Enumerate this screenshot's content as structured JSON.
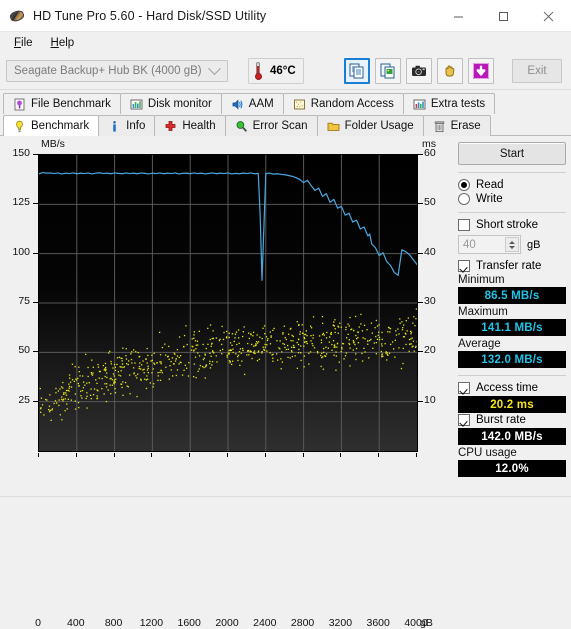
{
  "window": {
    "title": "HD Tune Pro 5.60 - Hard Disk/SSD Utility",
    "icon": "hdd-platter-icon",
    "minimize": "minimize-icon",
    "maximize": "maximize-icon",
    "close": "close-icon"
  },
  "menu": {
    "items": [
      {
        "label": "File",
        "accel": "F"
      },
      {
        "label": "Help",
        "accel": "H"
      }
    ]
  },
  "toolbar": {
    "drive": "Seagate Backup+ Hub BK (4000 gB)",
    "temperature": "46°C",
    "buttons": [
      {
        "name": "copy-text-button",
        "icon": "copy-document-icon",
        "selected": true
      },
      {
        "name": "copy-image-button",
        "icon": "copy-image-icon",
        "selected": false
      },
      {
        "name": "screenshot-button",
        "icon": "camera-icon",
        "selected": false
      },
      {
        "name": "hand-tool-button",
        "icon": "hand-icon",
        "selected": false
      },
      {
        "name": "save-button",
        "icon": "download-arrow-icon",
        "selected": false
      }
    ],
    "exit_label": "Exit"
  },
  "tabs": {
    "row1": [
      {
        "label": "File Benchmark",
        "icon": "file-benchmark-icon",
        "active": false
      },
      {
        "label": "Disk monitor",
        "icon": "disk-monitor-icon",
        "active": false
      },
      {
        "label": "AAM",
        "icon": "speaker-icon",
        "active": false
      },
      {
        "label": "Random Access",
        "icon": "random-access-icon",
        "active": false
      },
      {
        "label": "Extra tests",
        "icon": "extra-tests-icon",
        "active": false
      }
    ],
    "row2": [
      {
        "label": "Benchmark",
        "icon": "lightbulb-icon",
        "active": true
      },
      {
        "label": "Info",
        "icon": "info-icon",
        "active": false
      },
      {
        "label": "Health",
        "icon": "health-cross-icon",
        "active": false
      },
      {
        "label": "Error Scan",
        "icon": "magnifier-icon",
        "active": false
      },
      {
        "label": "Folder Usage",
        "icon": "folder-icon",
        "active": false
      },
      {
        "label": "Erase",
        "icon": "trash-icon",
        "active": false
      }
    ]
  },
  "panel": {
    "start_label": "Start",
    "read_label": "Read",
    "write_label": "Write",
    "read_selected": true,
    "short_stroke_label": "Short stroke",
    "short_stroke_checked": false,
    "short_stroke_value": "40",
    "short_stroke_unit": "gB",
    "transfer_rate_label": "Transfer rate",
    "transfer_rate_checked": true,
    "minimum_label": "Minimum",
    "minimum_value": "86.5 MB/s",
    "maximum_label": "Maximum",
    "maximum_value": "141.1 MB/s",
    "average_label": "Average",
    "average_value": "132.0 MB/s",
    "access_time_label": "Access time",
    "access_time_checked": true,
    "access_time_value": "20.2 ms",
    "burst_rate_label": "Burst rate",
    "burst_rate_checked": true,
    "burst_rate_value": "142.0 MB/s",
    "cpu_usage_label": "CPU usage",
    "cpu_usage_value": "12.0%"
  },
  "chart_data": {
    "type": "line",
    "title": "",
    "xlabel": "gB",
    "ylabel": "MB/s",
    "y2label": "ms",
    "xlim": [
      0,
      4000
    ],
    "ylim": [
      0,
      150
    ],
    "y2lim": [
      0,
      60
    ],
    "grid": true,
    "background": "#000000",
    "xticks": [
      0,
      400,
      800,
      1200,
      1600,
      2000,
      2400,
      2800,
      3200,
      3600,
      4000
    ],
    "xticklabels": [
      "0",
      "400",
      "800",
      "1200",
      "1600",
      "2000",
      "2400",
      "2800",
      "3200",
      "3600",
      "4000"
    ],
    "xunit_suffix": "gB",
    "yticks": [
      25,
      50,
      75,
      100,
      125,
      150
    ],
    "yticklabels": [
      "25",
      "50",
      "75",
      "100",
      "125",
      "150"
    ],
    "y2ticks": [
      10,
      20,
      30,
      40,
      50,
      60
    ],
    "y2ticklabels": [
      "10",
      "20",
      "30",
      "40",
      "50",
      "60"
    ],
    "series": [
      {
        "name": "Transfer rate",
        "type": "line",
        "color": "#4aa8e0",
        "axis": "left",
        "unit": "MB/s",
        "x": [
          0,
          40,
          80,
          120,
          160,
          200,
          240,
          280,
          320,
          360,
          400,
          440,
          480,
          520,
          560,
          600,
          640,
          680,
          720,
          760,
          800,
          840,
          880,
          920,
          960,
          1000,
          1040,
          1080,
          1120,
          1160,
          1200,
          1240,
          1280,
          1320,
          1360,
          1400,
          1440,
          1480,
          1520,
          1560,
          1600,
          1640,
          1680,
          1720,
          1760,
          1800,
          1840,
          1880,
          1920,
          1960,
          2000,
          2040,
          2080,
          2120,
          2160,
          2200,
          2240,
          2280,
          2320,
          2340,
          2360,
          2400,
          2440,
          2480,
          2520,
          2560,
          2600,
          2640,
          2680,
          2720,
          2760,
          2800,
          2840,
          2880,
          2920,
          2960,
          3000,
          3040,
          3080,
          3120,
          3160,
          3200,
          3240,
          3280,
          3320,
          3360,
          3400,
          3440,
          3480,
          3500,
          3520,
          3560,
          3600,
          3640,
          3680,
          3720,
          3760,
          3800,
          3840,
          3880,
          3920,
          3960,
          4000
        ],
        "y": [
          140.5,
          141.1,
          140.8,
          140.9,
          140.6,
          140.9,
          140.4,
          140.8,
          140.6,
          140.9,
          140.5,
          140.8,
          140.6,
          140.9,
          140.4,
          140.8,
          141.0,
          140.6,
          140.8,
          140.5,
          140.9,
          140.7,
          140.5,
          140.9,
          140.6,
          140.8,
          140.5,
          140.9,
          140.7,
          140.4,
          140.8,
          140.6,
          140.9,
          140.5,
          140.8,
          140.6,
          140.9,
          140.4,
          140.7,
          140.8,
          140.5,
          140.9,
          140.6,
          140.8,
          140.4,
          140.7,
          140.9,
          140.5,
          140.8,
          140.6,
          140.9,
          140.4,
          140.7,
          140.5,
          140.8,
          140.6,
          140.9,
          140.5,
          140.7,
          120.0,
          86.5,
          140.6,
          140.8,
          140.3,
          140.5,
          140.2,
          140.0,
          139.6,
          139.2,
          138.5,
          137.6,
          136.0,
          137.2,
          134.5,
          132.0,
          133.2,
          129.0,
          130.5,
          126.0,
          127.5,
          123.0,
          124.0,
          119.5,
          120.5,
          116.0,
          117.0,
          112.5,
          113.5,
          109.0,
          110.0,
          105.0,
          103.0,
          99.0,
          100.5,
          96.0,
          94.0,
          90.5,
          89.0,
          102.0,
          101.0,
          99.5,
          97.0,
          94.5,
          91.0,
          88.0
        ]
      },
      {
        "name": "Access time",
        "type": "scatter",
        "color": "#e8e817",
        "axis": "right",
        "unit": "ms",
        "description": "Random-access latency samples rising from ~8 ms near the outer tracks (0 gB) to ~25 ms toward 4000 gB; dense cloud, average 20.2 ms",
        "trend_x": [
          0,
          400,
          800,
          1200,
          1600,
          2000,
          2400,
          2800,
          3200,
          3600,
          4000
        ],
        "trend_y": [
          10,
          15,
          17,
          19,
          21,
          22,
          23,
          23.5,
          24,
          24.5,
          24.5
        ],
        "spread_ms": 6,
        "n_points": 760
      }
    ]
  }
}
